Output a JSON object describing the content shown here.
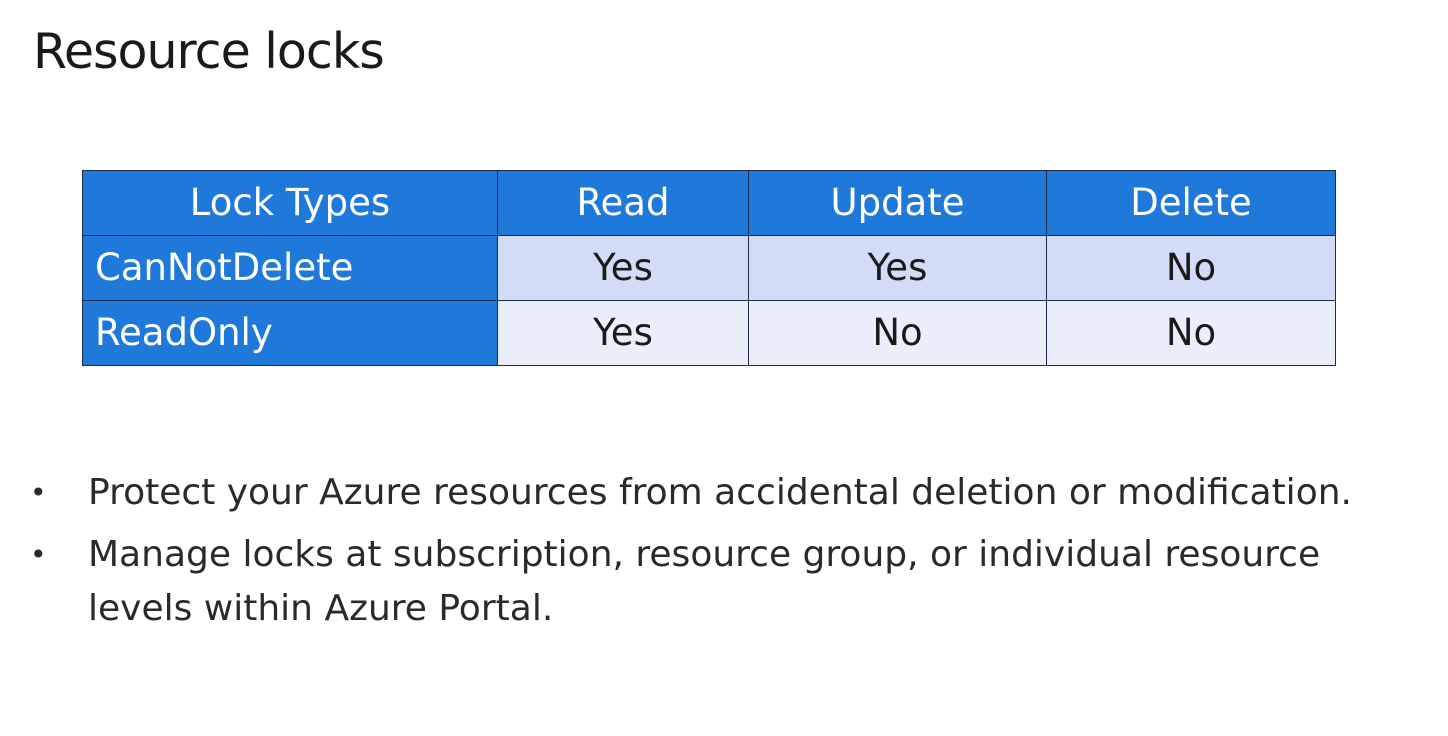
{
  "slide": {
    "title": "Resource locks"
  },
  "table": {
    "headers": [
      "Lock Types",
      "Read",
      "Update",
      "Delete"
    ],
    "rows": [
      {
        "label": "CanNotDelete",
        "cells": [
          "Yes",
          "Yes",
          "No"
        ]
      },
      {
        "label": "ReadOnly",
        "cells": [
          "Yes",
          "No",
          "No"
        ]
      }
    ]
  },
  "bullets": {
    "marker": "•",
    "items": [
      "Protect your Azure resources from accidental deletion or modification.",
      "Manage locks at subscription, resource group, or individual resource levels within Azure Portal."
    ]
  },
  "colors": {
    "header_bg": "#1f79db",
    "row1_bg": "#d2dcf6",
    "row2_bg": "#eaeefb",
    "border": "#1a2b4d"
  }
}
